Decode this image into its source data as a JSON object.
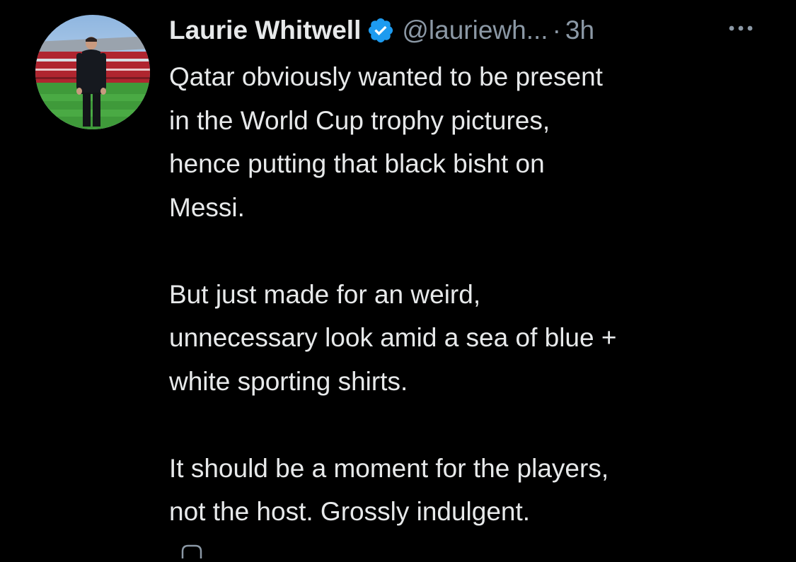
{
  "tweet": {
    "display_name": "Laurie Whitwell",
    "verified_icon": "verified-badge-icon",
    "handle": "@lauriewh...",
    "separator": "·",
    "timestamp": "3h",
    "more_icon": "more-horizontal-icon",
    "avatar": "profile-photo",
    "paragraphs": [
      {
        "lines": [
          "Qatar obviously wanted to be present",
          "in the World Cup trophy pictures,",
          "hence putting that black bisht on",
          "Messi."
        ]
      },
      {
        "lines": [
          "But just made for an weird,",
          "unnecessary look amid a sea of blue +",
          "white sporting shirts."
        ]
      },
      {
        "lines": [
          "It should be a moment for the players,",
          "not the host. Grossly indulgent."
        ]
      }
    ],
    "reply_icon": "reply-icon"
  },
  "colors": {
    "background": "#000000",
    "primary_text": "#e7e9ea",
    "secondary_text": "#8b98a5",
    "verified_blue": "#1d9bf0"
  }
}
